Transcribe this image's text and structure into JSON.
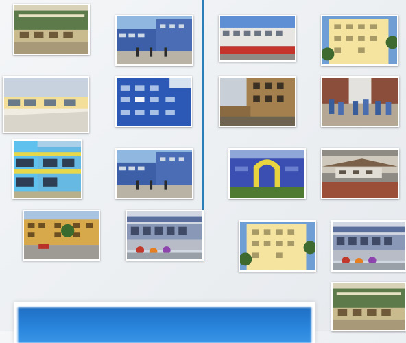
{
  "gallery": {
    "thumbnails": [
      {
        "scene": "school-courtyard-scene"
      },
      {
        "scene": "blue-school-building-photo"
      },
      {
        "scene": "school-red-wall-photo"
      },
      {
        "scene": "yellow-school-building-photo"
      },
      {
        "scene": "school-corridor-photo"
      },
      {
        "scene": "blue-multistory-school-photo"
      },
      {
        "scene": "brown-school-building-photo"
      },
      {
        "scene": "students-patio-photo"
      },
      {
        "scene": "light-blue-school-photo"
      },
      {
        "scene": "blue-school-building-photo"
      },
      {
        "scene": "school-arch-entrance-photo"
      },
      {
        "scene": "school-playground-photo"
      },
      {
        "scene": "yellow-school-street-photo"
      },
      {
        "scene": "school-gate-photo"
      },
      {
        "scene": "yellow-school-building-photo"
      },
      {
        "scene": "school-gate-photo"
      },
      {
        "scene": "school-courtyard-scene"
      }
    ]
  },
  "colors": {
    "divider": "#2b7fb8",
    "page_background": "#eef1f4",
    "banner_blue": "#2a86dd"
  }
}
